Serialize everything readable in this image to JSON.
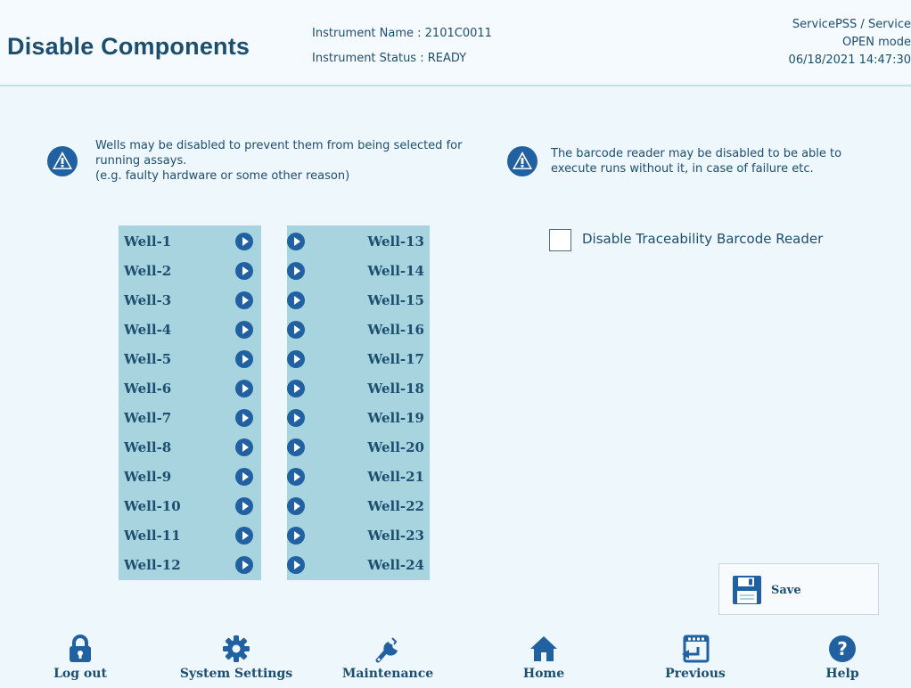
{
  "header": {
    "title": "Disable Components",
    "instrument_name": "Instrument Name : 2101C0011",
    "instrument_status": "Instrument Status : READY",
    "user": "ServicePSS / Service",
    "mode": "OPEN mode",
    "datetime": "06/18/2021 14:47:30"
  },
  "wells_info": {
    "line1": "Wells may be disabled to prevent them from being selected for",
    "line2": "running assays.",
    "line3": "(e.g. faulty hardware or some other reason)"
  },
  "barcode_info": {
    "line1": "The barcode reader may be disabled to be able to",
    "line2": "execute runs without it, in case of failure etc."
  },
  "wells_left": [
    "Well-1",
    "Well-2",
    "Well-3",
    "Well-4",
    "Well-5",
    "Well-6",
    "Well-7",
    "Well-8",
    "Well-9",
    "Well-10",
    "Well-11",
    "Well-12"
  ],
  "wells_right": [
    "Well-13",
    "Well-14",
    "Well-15",
    "Well-16",
    "Well-17",
    "Well-18",
    "Well-19",
    "Well-20",
    "Well-21",
    "Well-22",
    "Well-23",
    "Well-24"
  ],
  "barcode_checkbox": {
    "label": "Disable Traceability Barcode Reader",
    "checked": false
  },
  "save_label": "Save",
  "nav": {
    "logout": "Log out",
    "system_settings": "System Settings",
    "maintenance": "Maintenance",
    "home": "Home",
    "previous": "Previous",
    "help": "Help"
  },
  "colors": {
    "accent": "#1d4e6e",
    "well_panel": "#a7d4de",
    "button": "#2261a1"
  }
}
